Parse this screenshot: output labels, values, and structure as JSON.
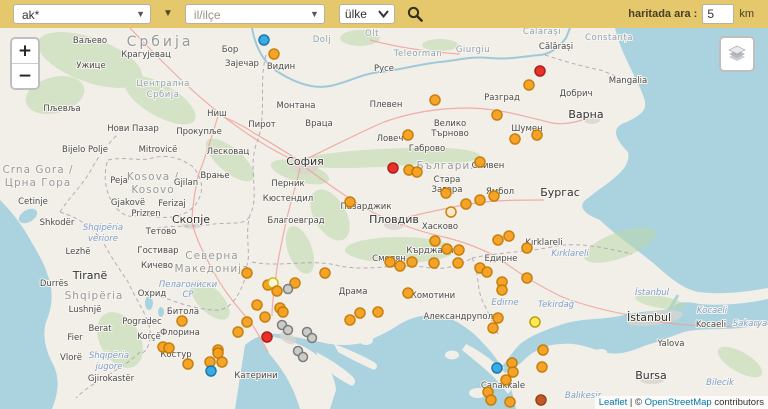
{
  "toolbar": {
    "bg_color": "#e5c86b",
    "search_value": "ak*",
    "city_placeholder": "il/ilçe",
    "country_label": "ülke",
    "radius_label": "haritada ara :",
    "radius_value": "5",
    "radius_unit": "km",
    "icons": {
      "search": "magnifier-icon",
      "dropdown": "chevron-down-icon"
    }
  },
  "controls": {
    "zoom_in": "+",
    "zoom_out": "−",
    "layers_icon": "layers-icon"
  },
  "attribution": {
    "leaflet": "Leaflet",
    "sep": " | © ",
    "osm": "OpenStreetMap",
    "rest": " contributors"
  },
  "map": {
    "colors": {
      "land": "#f2efe9",
      "water": "#aad3df",
      "forest": "#bcd8a8",
      "urban": "#d9d5ce",
      "road": "#f0a19a",
      "border": "#a89bb0"
    },
    "marker_palette": {
      "o": {
        "f": "#F6A01F",
        "s": "#C47A00"
      },
      "r": {
        "f": "#E8251F",
        "s": "#A81510"
      },
      "b": {
        "f": "#2EA8E6",
        "s": "#1173A8"
      },
      "g": {
        "f": "#C9C9C9",
        "s": "#767676"
      },
      "y": {
        "f": "#FFE94F",
        "s": "#B89B00"
      },
      "m": {
        "f": "#C05018",
        "s": "#8E3A0E"
      },
      "ro": {
        "f": "#F7E9C8",
        "s": "#D07C00"
      },
      "ry": {
        "f": "#FFFBE0",
        "s": "#D4B800"
      }
    },
    "markers": [
      [
        264,
        40,
        "b"
      ],
      [
        274,
        54,
        "o"
      ],
      [
        540,
        71,
        "r"
      ],
      [
        529,
        85,
        "o"
      ],
      [
        435,
        100,
        "o"
      ],
      [
        497,
        115,
        "o"
      ],
      [
        408,
        135,
        "o"
      ],
      [
        515,
        139,
        "o"
      ],
      [
        537,
        135,
        "o"
      ],
      [
        393,
        168,
        "r"
      ],
      [
        409,
        170,
        "o"
      ],
      [
        417,
        172,
        "o"
      ],
      [
        480,
        162,
        "o"
      ],
      [
        350,
        202,
        "o"
      ],
      [
        446,
        193,
        "o"
      ],
      [
        466,
        204,
        "o"
      ],
      [
        480,
        200,
        "o"
      ],
      [
        494,
        196,
        "o"
      ],
      [
        451,
        212,
        "ro"
      ],
      [
        435,
        241,
        "o"
      ],
      [
        447,
        249,
        "o"
      ],
      [
        459,
        250,
        "o"
      ],
      [
        390,
        262,
        "o"
      ],
      [
        400,
        266,
        "o"
      ],
      [
        412,
        262,
        "o"
      ],
      [
        434,
        263,
        "o"
      ],
      [
        458,
        263,
        "o"
      ],
      [
        480,
        268,
        "o"
      ],
      [
        487,
        272,
        "o"
      ],
      [
        498,
        240,
        "o"
      ],
      [
        509,
        236,
        "o"
      ],
      [
        527,
        248,
        "o"
      ],
      [
        502,
        282,
        "o"
      ],
      [
        527,
        278,
        "o"
      ],
      [
        502,
        290,
        "o"
      ],
      [
        408,
        293,
        "o"
      ],
      [
        498,
        318,
        "o"
      ],
      [
        493,
        328,
        "o"
      ],
      [
        535,
        322,
        "y"
      ],
      [
        543,
        350,
        "o"
      ],
      [
        497,
        368,
        "b"
      ],
      [
        512,
        363,
        "o"
      ],
      [
        513,
        372,
        "o"
      ],
      [
        542,
        367,
        "o"
      ],
      [
        506,
        380,
        "o"
      ],
      [
        488,
        392,
        "o"
      ],
      [
        491,
        400,
        "o"
      ],
      [
        510,
        402,
        "o"
      ],
      [
        541,
        400,
        "m"
      ],
      [
        247,
        273,
        "o"
      ],
      [
        268,
        285,
        "o"
      ],
      [
        273,
        283,
        "ry"
      ],
      [
        277,
        291,
        "o"
      ],
      [
        295,
        283,
        "o"
      ],
      [
        325,
        273,
        "o"
      ],
      [
        288,
        289,
        "g"
      ],
      [
        257,
        305,
        "o"
      ],
      [
        280,
        308,
        "o"
      ],
      [
        283,
        312,
        "o"
      ],
      [
        265,
        317,
        "o"
      ],
      [
        247,
        322,
        "o"
      ],
      [
        238,
        332,
        "o"
      ],
      [
        267,
        337,
        "r"
      ],
      [
        282,
        325,
        "g"
      ],
      [
        288,
        330,
        "g"
      ],
      [
        307,
        332,
        "g"
      ],
      [
        312,
        338,
        "g"
      ],
      [
        298,
        351,
        "g"
      ],
      [
        303,
        357,
        "g"
      ],
      [
        218,
        350,
        "o"
      ],
      [
        163,
        347,
        "o"
      ],
      [
        169,
        348,
        "o"
      ],
      [
        182,
        321,
        "o"
      ],
      [
        188,
        364,
        "o"
      ],
      [
        210,
        362,
        "o"
      ],
      [
        222,
        362,
        "o"
      ],
      [
        218,
        353,
        "o"
      ],
      [
        211,
        371,
        "b"
      ],
      [
        350,
        320,
        "o"
      ],
      [
        360,
        313,
        "o"
      ],
      [
        378,
        312,
        "o"
      ]
    ],
    "labels": [
      [
        "Србија",
        160,
        46,
        "country"
      ],
      [
        "Crna Gora /",
        38,
        173,
        "country-sm"
      ],
      [
        "Црна Гора",
        38,
        186,
        "country-sm"
      ],
      [
        "Kosova /",
        153,
        180,
        "country-sm"
      ],
      [
        "Kosovo",
        153,
        193,
        "country-sm"
      ],
      [
        "Северна",
        212,
        259,
        "country-sm"
      ],
      [
        "Македонија",
        212,
        272,
        "country-sm"
      ],
      [
        "Shqipëria",
        94,
        299,
        "country-sm"
      ],
      [
        "България",
        447,
        169,
        "country-sm"
      ],
      [
        "Централна",
        163,
        86,
        "region"
      ],
      [
        "Србија",
        163,
        97,
        "region"
      ],
      [
        "Olt",
        372,
        36,
        "region"
      ],
      [
        "Dolj",
        322,
        42,
        "region"
      ],
      [
        "Teleorman",
        418,
        56,
        "region"
      ],
      [
        "Giurgiu",
        473,
        52,
        "region"
      ],
      [
        "Călărași",
        542,
        34,
        "region"
      ],
      [
        "Constanța",
        609,
        40,
        "region"
      ],
      [
        "Пелагониски",
        188,
        287,
        "region-it"
      ],
      [
        "СР",
        188,
        297,
        "region-it"
      ],
      [
        "Shqipëria",
        103,
        230,
        "region-it"
      ],
      [
        "veriore",
        103,
        241,
        "region-it"
      ],
      [
        "Shqipëria",
        109,
        358,
        "region-it"
      ],
      [
        "jugore",
        109,
        369,
        "region-it"
      ],
      [
        "Edirne",
        505,
        305,
        "region-it"
      ],
      [
        "Tekirdağ",
        556,
        307,
        "region-it"
      ],
      [
        "Kırklareli",
        570,
        256,
        "region-it"
      ],
      [
        "İstanbul",
        652,
        295,
        "region-it"
      ],
      [
        "Kocaeli",
        712,
        313,
        "region-it"
      ],
      [
        "Sakarya",
        750,
        326,
        "region-it"
      ],
      [
        "Bilecik",
        720,
        385,
        "region-it"
      ],
      [
        "Balıkesir",
        583,
        398,
        "region-it"
      ],
      [
        "Ваљево",
        90,
        43,
        "city"
      ],
      [
        "Ужице",
        91,
        68,
        "city"
      ],
      [
        "Пљевља",
        62,
        111,
        "city"
      ],
      [
        "Bijelo Polje",
        85,
        152,
        "city"
      ],
      [
        "Крагујевац",
        146,
        57,
        "city"
      ],
      [
        "Бор",
        230,
        52,
        "city"
      ],
      [
        "Зајечар",
        242,
        66,
        "city"
      ],
      [
        "Видин",
        281,
        69,
        "city"
      ],
      [
        "Монтана",
        296,
        108,
        "city"
      ],
      [
        "Враца",
        319,
        126,
        "city"
      ],
      [
        "Ниш",
        217,
        116,
        "city"
      ],
      [
        "Прокупље",
        199,
        134,
        "city"
      ],
      [
        "Нови Пазар",
        133,
        131,
        "city"
      ],
      [
        "Пирот",
        262,
        127,
        "city"
      ],
      [
        "Лесковац",
        228,
        154,
        "city"
      ],
      [
        "Врање",
        215,
        178,
        "city"
      ],
      [
        "Mitrovicë",
        158,
        152,
        "city"
      ],
      [
        "Peja",
        119,
        183,
        "city"
      ],
      [
        "Gjilan",
        186,
        185,
        "city"
      ],
      [
        "Gjakovë",
        128,
        205,
        "city"
      ],
      [
        "Ferizaj",
        172,
        206,
        "city"
      ],
      [
        "Prizren",
        146,
        216,
        "city"
      ],
      [
        "Скопје",
        191,
        223,
        "city-lg"
      ],
      [
        "Тетово",
        161,
        234,
        "city"
      ],
      [
        "Гостивар",
        158,
        253,
        "city"
      ],
      [
        "Кичево",
        157,
        268,
        "city"
      ],
      [
        "Cetinje",
        33,
        204,
        "city"
      ],
      [
        "Shkodër",
        57,
        225,
        "city"
      ],
      [
        "Lezhë",
        78,
        254,
        "city"
      ],
      [
        "Tiranë",
        90,
        279,
        "city-lg"
      ],
      [
        "Durrës",
        54,
        286,
        "city"
      ],
      [
        "Lushnjë",
        85,
        312,
        "city"
      ],
      [
        "Pogradec",
        142,
        324,
        "city"
      ],
      [
        "Охрид",
        152,
        296,
        "city"
      ],
      [
        "Битола",
        183,
        314,
        "city"
      ],
      [
        "Korçë",
        149,
        339,
        "city"
      ],
      [
        "Berat",
        100,
        331,
        "city"
      ],
      [
        "Fier",
        75,
        340,
        "city"
      ],
      [
        "Vlorë",
        71,
        360,
        "city"
      ],
      [
        "Gjirokastër",
        111,
        381,
        "city"
      ],
      [
        "Костур",
        176,
        357,
        "city"
      ],
      [
        "Флорина",
        180,
        335,
        "city"
      ],
      [
        "Катерини",
        256,
        378,
        "city"
      ],
      [
        "Драма",
        353,
        294,
        "city"
      ],
      [
        "Комотини",
        433,
        298,
        "city"
      ],
      [
        "Александруполи",
        461,
        319,
        "city"
      ],
      [
        "София",
        305,
        165,
        "city-lg"
      ],
      [
        "Перник",
        288,
        186,
        "city"
      ],
      [
        "Кюстендил",
        288,
        201,
        "city"
      ],
      [
        "Благоевград",
        296,
        223,
        "city"
      ],
      [
        "Пазарджик",
        366,
        209,
        "city"
      ],
      [
        "Пловдив",
        394,
        223,
        "city-lg"
      ],
      [
        "Хасково",
        440,
        229,
        "city"
      ],
      [
        "Кърджали",
        430,
        253,
        "city"
      ],
      [
        "Смолян",
        389,
        261,
        "city"
      ],
      [
        "Плевен",
        386,
        107,
        "city"
      ],
      [
        "Ловеч",
        390,
        141,
        "city"
      ],
      [
        "Габрово",
        427,
        151,
        "city"
      ],
      [
        "Велико",
        450,
        126,
        "city"
      ],
      [
        "Търново",
        450,
        136,
        "city"
      ],
      [
        "Русе",
        384,
        71,
        "city"
      ],
      [
        "Разград",
        502,
        100,
        "city"
      ],
      [
        "Шумен",
        527,
        131,
        "city"
      ],
      [
        "Сливен",
        488,
        168,
        "city"
      ],
      [
        "Стара",
        447,
        182,
        "city"
      ],
      [
        "Загора",
        447,
        192,
        "city"
      ],
      [
        "Ямбол",
        500,
        194,
        "city"
      ],
      [
        "Бургас",
        560,
        196,
        "city-lg"
      ],
      [
        "Варна",
        586,
        118,
        "city-lg"
      ],
      [
        "Добрич",
        576,
        96,
        "city"
      ],
      [
        "Mangalia",
        628,
        83,
        "city"
      ],
      [
        "Călărași",
        556,
        49,
        "city"
      ],
      [
        "Едирне",
        501,
        261,
        "city"
      ],
      [
        "Kırklareli",
        544,
        245,
        "city"
      ],
      [
        "İstanbul",
        649,
        321,
        "city-lg"
      ],
      [
        "Kocaeli",
        711,
        327,
        "city"
      ],
      [
        "Yalova",
        671,
        346,
        "city"
      ],
      [
        "Bursa",
        651,
        379,
        "city-lg"
      ],
      [
        "Çanakkale",
        503,
        388,
        "city"
      ]
    ]
  }
}
